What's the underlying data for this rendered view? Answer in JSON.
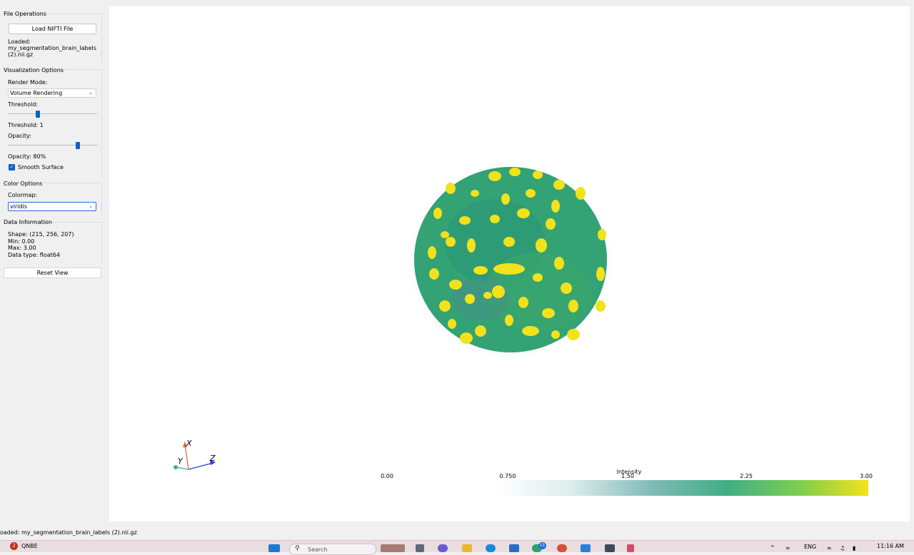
{
  "status_bar": "oaded: my_segmentation_brain_labels (2).nii.gz",
  "panel": {
    "file_ops": {
      "title": "File Operations",
      "load_button": "Load NIFTI File",
      "loaded_line1": "Loaded:",
      "loaded_line2": "my_segmentation_brain_labels",
      "loaded_line3": "(2).nii.gz"
    },
    "viz": {
      "title": "Visualization Options",
      "render_mode_label": "Render Mode:",
      "render_mode_value": "Volume Rendering",
      "threshold_label": "Threshold:",
      "threshold_value_text": "Threshold: 1",
      "threshold_fraction": 0.33,
      "opacity_label": "Opacity:",
      "opacity_value_text": "Opacity: 80%",
      "opacity_fraction": 0.8,
      "smooth_label": "Smooth Surface",
      "smooth_checked": true
    },
    "color": {
      "title": "Color Options",
      "colormap_label": "Colormap:",
      "colormap_value": "viridis"
    },
    "data_info": {
      "title": "Data Information",
      "shape": "Shape: (215, 256, 207)",
      "min": "Min: 0.00",
      "max": "Max: 3.00",
      "dtype": "Data type: float64"
    },
    "reset_button": "Reset View"
  },
  "viewport": {
    "axes": {
      "x": "X",
      "y": "Y",
      "z": "Z"
    },
    "colorbar": {
      "title": "Intensity",
      "ticks": [
        "0.00",
        "0.750",
        "1.50",
        "2.25",
        "3.00"
      ],
      "colors": [
        "#ffffff",
        "#dcecec",
        "#7fbab6",
        "#3fae84",
        "#7fcf4e",
        "#f4e218"
      ]
    }
  },
  "taskbar": {
    "notification_badge": "2",
    "stock_label": "QNBE",
    "search_placeholder": "Search",
    "language": "ENG",
    "time": "11:16 AM",
    "app_badge": "11"
  }
}
